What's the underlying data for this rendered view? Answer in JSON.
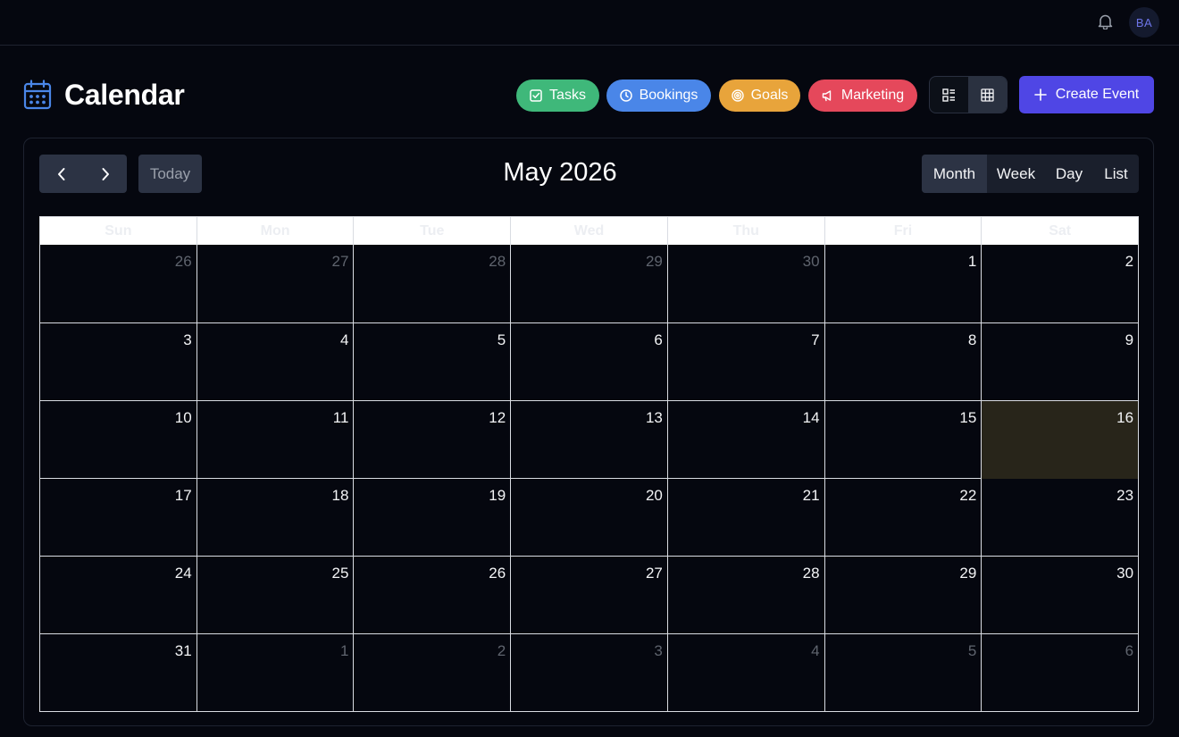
{
  "topbar": {
    "bell_icon": "bell-icon",
    "avatar_initials": "BA"
  },
  "header": {
    "icon": "calendar-icon",
    "title": "Calendar",
    "filters": [
      {
        "label": "Tasks",
        "icon": "checkbox-icon",
        "color": "#3fb87a"
      },
      {
        "label": "Bookings",
        "icon": "clock-icon",
        "color": "#4a86e8"
      },
      {
        "label": "Goals",
        "icon": "target-icon",
        "color": "#e8a43b"
      },
      {
        "label": "Marketing",
        "icon": "megaphone-icon",
        "color": "#e5485b"
      }
    ],
    "view_toggle": [
      {
        "icon": "list-view-icon",
        "active": false
      },
      {
        "icon": "grid-view-icon",
        "active": true
      }
    ],
    "create_label": "Create Event",
    "accent": "#4f46e5"
  },
  "calendar": {
    "month_title": "May 2026",
    "today_label": "Today",
    "modes": [
      {
        "label": "Month",
        "active": true
      },
      {
        "label": "Week",
        "active": false
      },
      {
        "label": "Day",
        "active": false
      },
      {
        "label": "List",
        "active": false
      }
    ],
    "weekdays": [
      "Sun",
      "Mon",
      "Tue",
      "Wed",
      "Thu",
      "Fri",
      "Sat"
    ],
    "weeks": [
      [
        {
          "d": "26",
          "other": true
        },
        {
          "d": "27",
          "other": true
        },
        {
          "d": "28",
          "other": true
        },
        {
          "d": "29",
          "other": true
        },
        {
          "d": "30",
          "other": true
        },
        {
          "d": "1"
        },
        {
          "d": "2"
        }
      ],
      [
        {
          "d": "3"
        },
        {
          "d": "4"
        },
        {
          "d": "5"
        },
        {
          "d": "6"
        },
        {
          "d": "7"
        },
        {
          "d": "8"
        },
        {
          "d": "9"
        }
      ],
      [
        {
          "d": "10"
        },
        {
          "d": "11"
        },
        {
          "d": "12"
        },
        {
          "d": "13"
        },
        {
          "d": "14"
        },
        {
          "d": "15"
        },
        {
          "d": "16",
          "today": true
        }
      ],
      [
        {
          "d": "17"
        },
        {
          "d": "18"
        },
        {
          "d": "19"
        },
        {
          "d": "20"
        },
        {
          "d": "21"
        },
        {
          "d": "22"
        },
        {
          "d": "23"
        }
      ],
      [
        {
          "d": "24"
        },
        {
          "d": "25"
        },
        {
          "d": "26"
        },
        {
          "d": "27"
        },
        {
          "d": "28"
        },
        {
          "d": "29"
        },
        {
          "d": "30"
        }
      ],
      [
        {
          "d": "31"
        },
        {
          "d": "1",
          "other": true
        },
        {
          "d": "2",
          "other": true
        },
        {
          "d": "3",
          "other": true
        },
        {
          "d": "4",
          "other": true
        },
        {
          "d": "5",
          "other": true
        },
        {
          "d": "6",
          "other": true
        }
      ]
    ],
    "today_color": "#28251a"
  }
}
